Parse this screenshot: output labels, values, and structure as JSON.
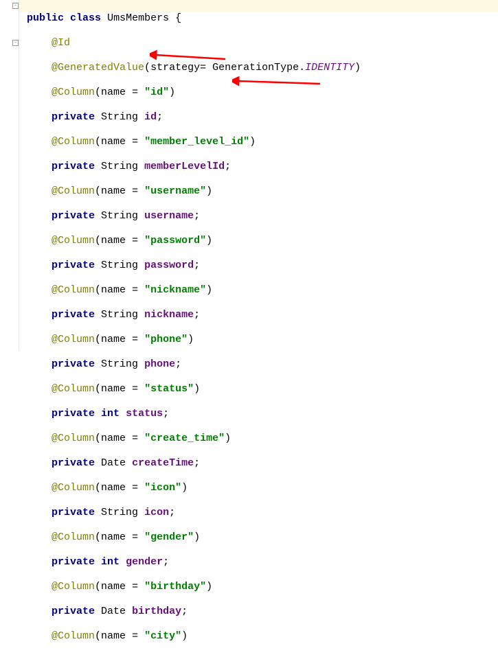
{
  "tokens": {
    "public": "public",
    "class": "class",
    "className": "UmsMembers",
    "private": "private",
    "int": "int",
    "String": "String",
    "Date": "Date",
    "Id": "@Id",
    "GeneratedValue": "@GeneratedValue",
    "Column": "@Column",
    "strategy": "strategy",
    "GenerationType": "GenerationType",
    "IDENTITY": "IDENTITY",
    "name": "name",
    "openBrace": "{",
    "eq": "=",
    "eqSp": "= ",
    "comma": ",",
    "semicolon": ";",
    "openParen": "(",
    "closeParen": ")",
    "dot": "."
  },
  "columns": {
    "id": "\"id\"",
    "memberLevelId": "\"member_level_id\"",
    "username": "\"username\"",
    "password": "\"password\"",
    "nickname": "\"nickname\"",
    "phone": "\"phone\"",
    "status": "\"status\"",
    "createTime": "\"create_time\"",
    "icon": "\"icon\"",
    "gender": "\"gender\"",
    "birthday": "\"birthday\"",
    "city": "\"city\""
  },
  "fields": {
    "id": "id",
    "memberLevelId": "memberLevelId",
    "username": "username",
    "password": "password",
    "nickname": "nickname",
    "phone": "phone",
    "status": "status",
    "createTime": "createTime",
    "icon": "icon",
    "gender": "gender",
    "birthday": "birthday"
  }
}
